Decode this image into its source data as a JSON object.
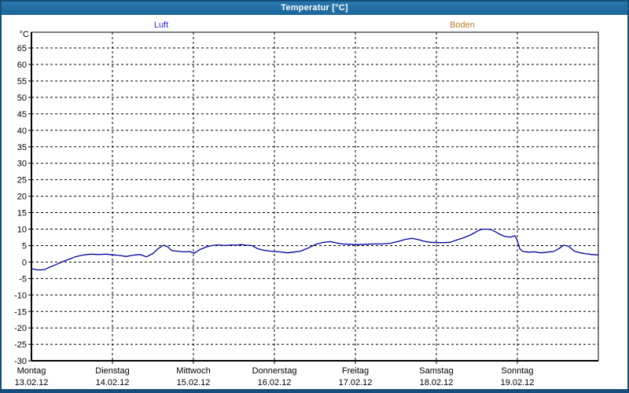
{
  "window": {
    "title": "Temperatur [°C]"
  },
  "legend": [
    {
      "label": "Luft",
      "color": "#2a2ad0"
    },
    {
      "label": "Boden",
      "color": "#bd7b25"
    }
  ],
  "axis": {
    "unit_label": "°C"
  },
  "chart_data": {
    "type": "line",
    "title": "Temperatur [°C]",
    "ylabel": "°C",
    "ylim": [
      -30,
      70
    ],
    "grid": true,
    "legend_position": "top",
    "y_ticks": [
      65,
      60,
      55,
      50,
      45,
      40,
      35,
      30,
      25,
      20,
      15,
      10,
      5,
      0,
      -5,
      -10,
      -15,
      -20,
      -25,
      -30
    ],
    "x_categories": [
      {
        "name": "Montag",
        "date": "13.02.12"
      },
      {
        "name": "Dienstag",
        "date": "14.02.12"
      },
      {
        "name": "Mittwoch",
        "date": "15.02.12"
      },
      {
        "name": "Donnerstag",
        "date": "16.02.12"
      },
      {
        "name": "Freitag",
        "date": "17.02.12"
      },
      {
        "name": "Samstag",
        "date": "18.02.12"
      },
      {
        "name": "Sonntag",
        "date": "19.02.12"
      }
    ],
    "series": [
      {
        "name": "Luft",
        "color": "#0000a0",
        "points": [
          [
            0.0,
            -2.0
          ],
          [
            0.08,
            -2.4
          ],
          [
            0.16,
            -2.3
          ],
          [
            0.23,
            -1.5
          ],
          [
            0.31,
            -0.7
          ],
          [
            0.39,
            0.2
          ],
          [
            0.47,
            0.9
          ],
          [
            0.54,
            1.6
          ],
          [
            0.63,
            2.1
          ],
          [
            0.73,
            2.4
          ],
          [
            0.83,
            2.3
          ],
          [
            0.92,
            2.4
          ],
          [
            1.0,
            2.2
          ],
          [
            1.09,
            2.0
          ],
          [
            1.17,
            1.7
          ],
          [
            1.26,
            2.1
          ],
          [
            1.34,
            2.3
          ],
          [
            1.42,
            1.6
          ],
          [
            1.5,
            2.6
          ],
          [
            1.56,
            4.0
          ],
          [
            1.63,
            5.1
          ],
          [
            1.68,
            4.7
          ],
          [
            1.73,
            3.5
          ],
          [
            1.81,
            3.3
          ],
          [
            1.88,
            3.1
          ],
          [
            1.95,
            3.2
          ],
          [
            2.01,
            2.7
          ],
          [
            2.08,
            3.8
          ],
          [
            2.16,
            4.6
          ],
          [
            2.23,
            5.0
          ],
          [
            2.31,
            5.2
          ],
          [
            2.39,
            5.0
          ],
          [
            2.47,
            5.2
          ],
          [
            2.52,
            5.1
          ],
          [
            2.59,
            5.3
          ],
          [
            2.65,
            5.1
          ],
          [
            2.72,
            5.0
          ],
          [
            2.79,
            4.1
          ],
          [
            2.86,
            3.6
          ],
          [
            2.96,
            3.3
          ],
          [
            3.06,
            3.1
          ],
          [
            3.16,
            2.8
          ],
          [
            3.23,
            3.0
          ],
          [
            3.32,
            3.3
          ],
          [
            3.42,
            4.3
          ],
          [
            3.51,
            5.4
          ],
          [
            3.61,
            6.0
          ],
          [
            3.69,
            6.2
          ],
          [
            3.77,
            5.8
          ],
          [
            3.84,
            5.5
          ],
          [
            3.94,
            5.4
          ],
          [
            4.04,
            5.3
          ],
          [
            4.14,
            5.4
          ],
          [
            4.23,
            5.5
          ],
          [
            4.33,
            5.5
          ],
          [
            4.43,
            5.7
          ],
          [
            4.52,
            6.2
          ],
          [
            4.62,
            6.9
          ],
          [
            4.7,
            7.2
          ],
          [
            4.78,
            6.8
          ],
          [
            4.85,
            6.3
          ],
          [
            4.93,
            6.0
          ],
          [
            5.01,
            5.9
          ],
          [
            5.09,
            5.9
          ],
          [
            5.17,
            6.0
          ],
          [
            5.24,
            6.6
          ],
          [
            5.34,
            7.4
          ],
          [
            5.42,
            8.2
          ],
          [
            5.5,
            9.3
          ],
          [
            5.55,
            9.9
          ],
          [
            5.61,
            10.0
          ],
          [
            5.67,
            9.9
          ],
          [
            5.73,
            9.2
          ],
          [
            5.8,
            8.2
          ],
          [
            5.86,
            7.7
          ],
          [
            5.92,
            7.6
          ],
          [
            5.97,
            8.0
          ],
          [
            6.0,
            6.5
          ],
          [
            6.03,
            4.0
          ],
          [
            6.07,
            3.2
          ],
          [
            6.14,
            3.0
          ],
          [
            6.21,
            3.1
          ],
          [
            6.29,
            2.8
          ],
          [
            6.37,
            3.0
          ],
          [
            6.45,
            3.2
          ],
          [
            6.52,
            4.2
          ],
          [
            6.57,
            5.1
          ],
          [
            6.63,
            4.8
          ],
          [
            6.7,
            3.4
          ],
          [
            6.78,
            2.8
          ],
          [
            6.85,
            2.5
          ],
          [
            6.92,
            2.3
          ],
          [
            6.99,
            2.2
          ]
        ]
      }
    ]
  }
}
